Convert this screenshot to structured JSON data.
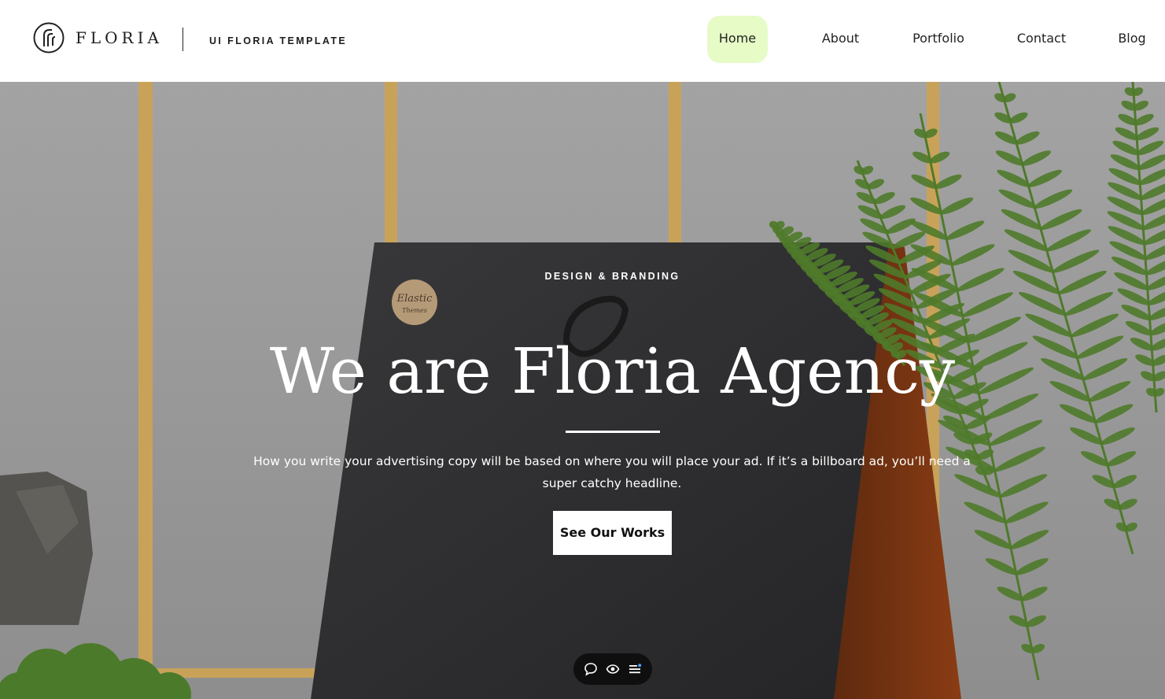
{
  "header": {
    "brand": "FLORIA",
    "tagline": "UI FLORIA TEMPLATE",
    "nav": [
      {
        "label": "Home",
        "active": true
      },
      {
        "label": "About",
        "active": false
      },
      {
        "label": "Portfolio",
        "active": false
      },
      {
        "label": "Contact",
        "active": false
      },
      {
        "label": "Blog",
        "active": false
      }
    ]
  },
  "hero": {
    "eyebrow": "DESIGN & BRANDING",
    "headline": "We are Floria Agency",
    "lead": "How you write your advertising copy will be based on where you will place your ad. If it’s a billboard ad, you’ll need a super catchy headline.",
    "cta_label": "See Our Works",
    "sticker_text": [
      "Elastic",
      "Themes"
    ]
  },
  "toolbar": {
    "icons": [
      "chat-icon",
      "eye-icon",
      "menu-icon"
    ]
  },
  "colors": {
    "nav_active_bg": "#e6fbc6",
    "hero_bg": "#9a9a9a",
    "fern": "#4f7a2a",
    "frame_gold": "#c9a25a",
    "bag": "#2e2e30",
    "bag_side": "#7a3512"
  }
}
